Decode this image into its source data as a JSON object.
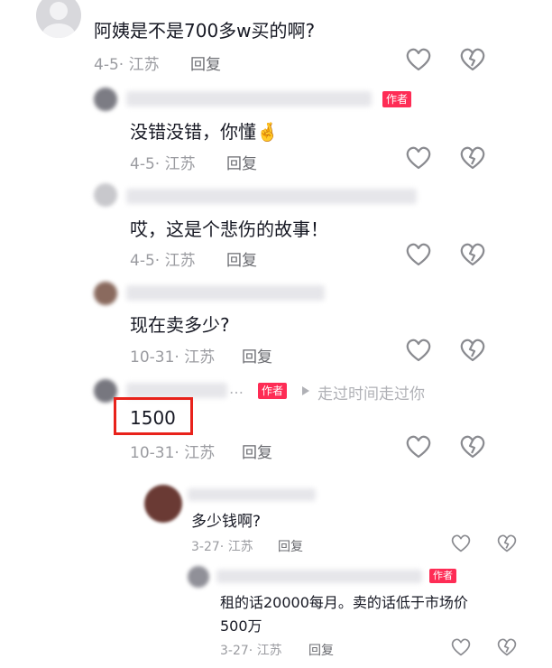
{
  "comments": [
    {
      "text": "阿姨是不是700多w买的啊?",
      "date": "4-5",
      "location": "江苏",
      "reply_label": "回复"
    },
    {
      "text": "没错没错，你懂",
      "emoji": "🤞",
      "date": "4-5",
      "location": "江苏",
      "reply_label": "回复",
      "author_badge": "作者"
    },
    {
      "text": "哎，这是个悲伤的故事！",
      "date": "4-5",
      "location": "江苏",
      "reply_label": "回复"
    },
    {
      "text": "现在卖多少?",
      "date": "10-31",
      "location": "江苏",
      "reply_label": "回复"
    },
    {
      "text": "1500",
      "date": "10-31",
      "location": "江苏",
      "reply_label": "回复",
      "author_badge": "作者",
      "name_suffix": "…",
      "reply_to": "走过时间走过你"
    },
    {
      "text": "多少钱啊?",
      "date": "3-27",
      "location": "江苏",
      "reply_label": "回复"
    },
    {
      "text_line1": "租的话20000每月。卖的话低于市场价",
      "text_line2": "500万",
      "date": "3-27",
      "location": "江苏",
      "reply_label": "回复",
      "author_badge": "作者"
    }
  ],
  "colors": {
    "badge": "#fe2c55",
    "highlight": "#e8221b",
    "meta": "#9a9ba0"
  }
}
